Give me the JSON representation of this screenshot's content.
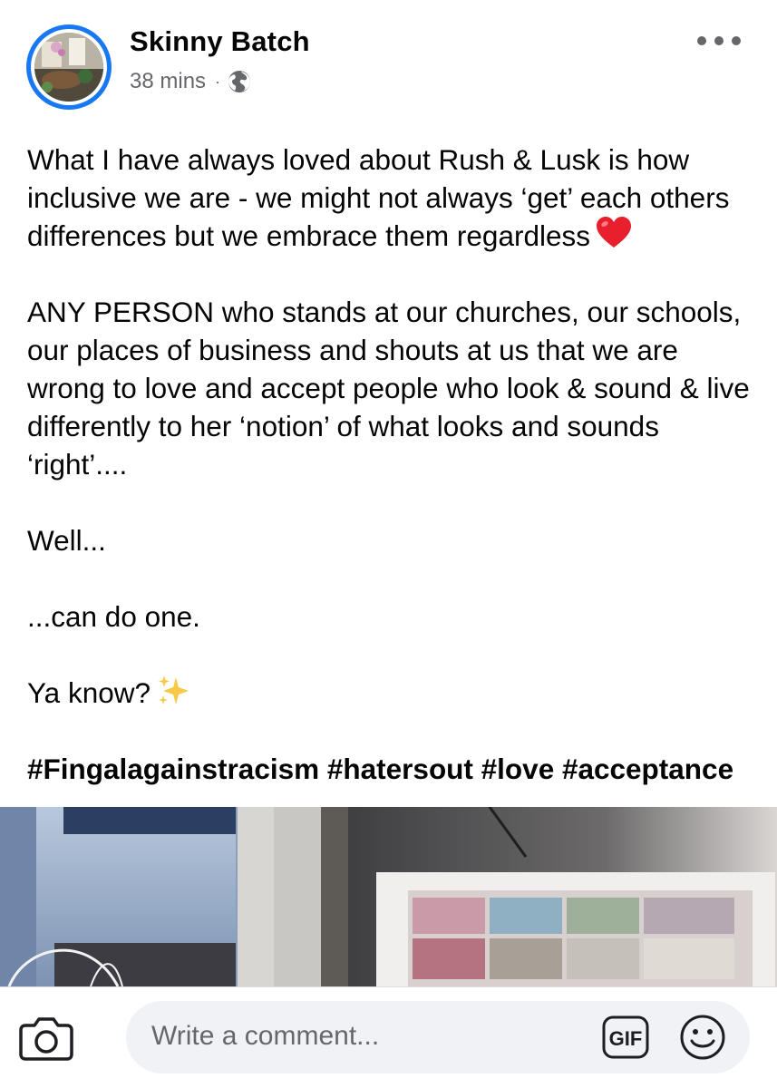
{
  "post": {
    "author": "Skinny Batch",
    "time": "38 mins",
    "separator": "·",
    "privacy_icon": "globe-icon",
    "paragraphs": [
      "What I have always loved about Rush & Lusk is how inclusive we are - we might not always ‘get’ each others differences but we embrace them regardless",
      "ANY PERSON who stands at our churches, our schools, our places of business and shouts at us that we are wrong to love and accept people who look & sound & live differently to her ‘notion’ of what looks and sounds ‘right’....",
      "Well...",
      "...can do one.",
      "Ya know?"
    ],
    "hashtags": "#Fingalagainstracism #hatersout #love #acceptance"
  },
  "comment_bar": {
    "placeholder": "Write a comment...",
    "gif_label": "GIF",
    "camera_icon": "camera-icon",
    "emoji_icon": "smiley-icon"
  },
  "colors": {
    "accent": "#1877f2",
    "secondary_text": "#65676b",
    "input_bg": "#f0f2f5"
  }
}
